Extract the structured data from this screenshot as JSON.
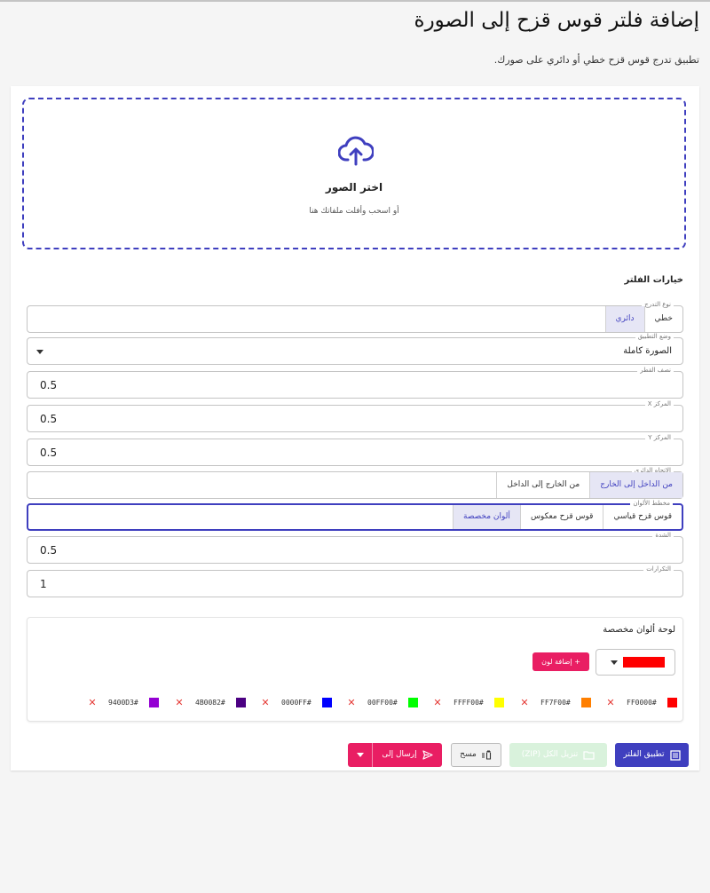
{
  "page": {
    "title": "إضافة فلتر قوس قزح إلى الصورة",
    "description": "تطبيق تدرج قوس قزح خطي أو دائري على صورك."
  },
  "upload": {
    "title": "اختر الصور",
    "subtitle": "أو اسحب وأفلت ملفاتك هنا"
  },
  "options": {
    "title": "خيارات الفلتر",
    "gradient_type": {
      "label": "نوع التدرج",
      "options": [
        "خطي",
        "دائري"
      ],
      "selected": "دائري"
    },
    "apply_mode": {
      "label": "وضع التطبيق",
      "value": "الصورة كاملة"
    },
    "radius": {
      "label": "نصف القطر",
      "value": "0.5"
    },
    "center_x": {
      "label": "المركز X",
      "value": "0.5"
    },
    "center_y": {
      "label": "المركز Y",
      "value": "0.5"
    },
    "direction": {
      "label": "الاتجاه الدائري",
      "options": [
        "من الداخل إلى الخارج",
        "من الخارج إلى الداخل"
      ],
      "selected": "من الداخل إلى الخارج"
    },
    "color_scheme": {
      "label": "مخطط الألوان",
      "options": [
        "قوس قزح قياسي",
        "قوس قزح معكوس",
        "ألوان مخصصة"
      ],
      "selected": "ألوان مخصصة"
    },
    "intensity": {
      "label": "الشدة",
      "value": "0.5"
    },
    "repetitions": {
      "label": "التكرارات",
      "value": "1"
    }
  },
  "palette": {
    "title": "لوحة ألوان مخصصة",
    "current_color": "#FF0000",
    "add_label": "إضافة لون",
    "colors": [
      "#FF0000",
      "#FF7F00",
      "#FFFF00",
      "#00FF00",
      "#0000FF",
      "#4B0082",
      "#9400D3"
    ]
  },
  "actions": {
    "apply": "تطبيق الفلتر",
    "download_zip": "تنزيل الكل (ZIP)",
    "clear": "مسح",
    "send_to": "إرسال إلى"
  },
  "colors": {
    "primary": "#3f3fbf",
    "accent": "#e91e63",
    "remove": "#e53935"
  }
}
